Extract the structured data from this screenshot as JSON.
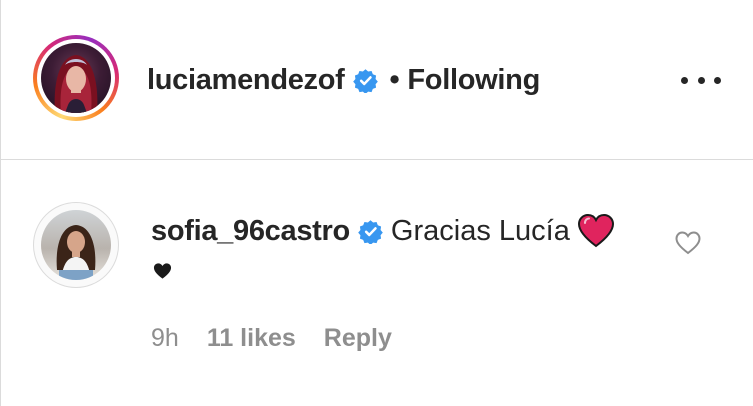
{
  "post_header": {
    "username": "luciamendezof",
    "separator": "•",
    "follow_status": "Following",
    "verified_icon": "verified-badge-icon",
    "more_icon": "more-options-icon",
    "ring_colors": [
      "#feda75",
      "#fa7e1e",
      "#d62976",
      "#962fbf"
    ]
  },
  "comment": {
    "username": "sofia_96castro",
    "text": "Gracias Lucía",
    "emoji_1": "red-heart-icon",
    "emoji_2": "black-heart-icon",
    "time": "9h",
    "likes": "11 likes",
    "reply_label": "Reply",
    "like_icon": "heart-outline-icon"
  },
  "colors": {
    "text": "#262626",
    "muted": "#8e8e8e",
    "verified": "#3897f0",
    "heart_red": "#e0245e",
    "divider": "#dbdbdb"
  }
}
